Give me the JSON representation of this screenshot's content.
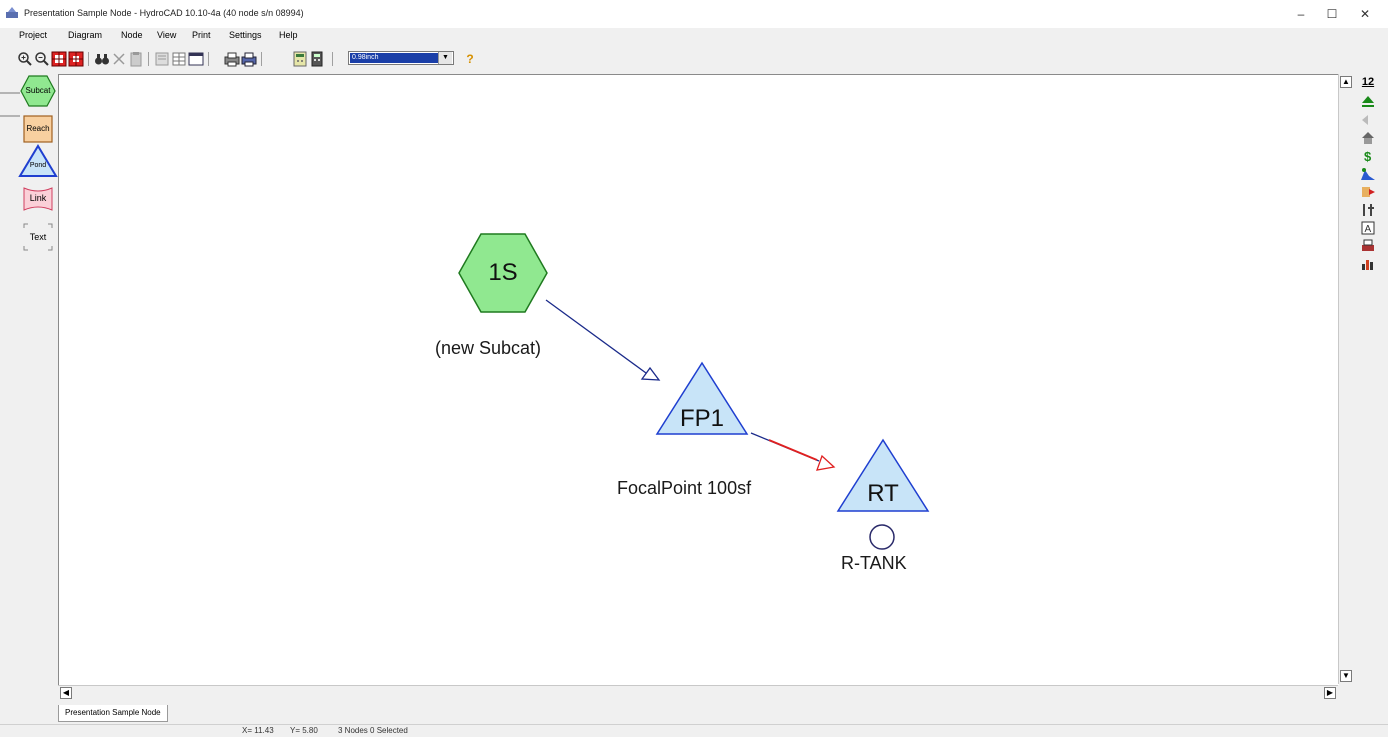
{
  "window": {
    "title": "Presentation Sample Node - HydroCAD 10.10-4a (40 node s/n 08994)",
    "minimize": "–",
    "maximize": "☐",
    "close": "✕"
  },
  "menu": [
    "Project",
    "Diagram",
    "Node",
    "View",
    "Print",
    "Settings",
    "Help"
  ],
  "toolbar": {
    "zoom_value": "0.98inch",
    "help_label": "?"
  },
  "palette": {
    "subcat": "Subcat",
    "reach": "Reach",
    "pond": "Pond",
    "link": "Link",
    "text": "Text"
  },
  "diagram": {
    "nodes": [
      {
        "id": "1S",
        "type": "subcat",
        "label": "(new Subcat)"
      },
      {
        "id": "FP1",
        "type": "pond",
        "label": "FocalPoint 100sf"
      },
      {
        "id": "RT",
        "type": "pond",
        "label": "R-TANK"
      }
    ],
    "links": [
      {
        "from": "1S",
        "to": "FP1",
        "color": "#1a2a8a"
      },
      {
        "from": "FP1",
        "to": "RT",
        "color": "#e02020"
      }
    ]
  },
  "colors": {
    "subcat_fill": "#90e890",
    "subcat_stroke": "#1f7a1f",
    "pond_fill": "#c8e4f8",
    "pond_stroke": "#1f3fd0"
  },
  "right_toolbar": {
    "number_label": "12"
  },
  "tab": {
    "label": "Presentation Sample Node"
  },
  "status": {
    "x": "X= 11.43",
    "y": "Y= 5.80",
    "selection": "3 Nodes 0 Selected"
  }
}
